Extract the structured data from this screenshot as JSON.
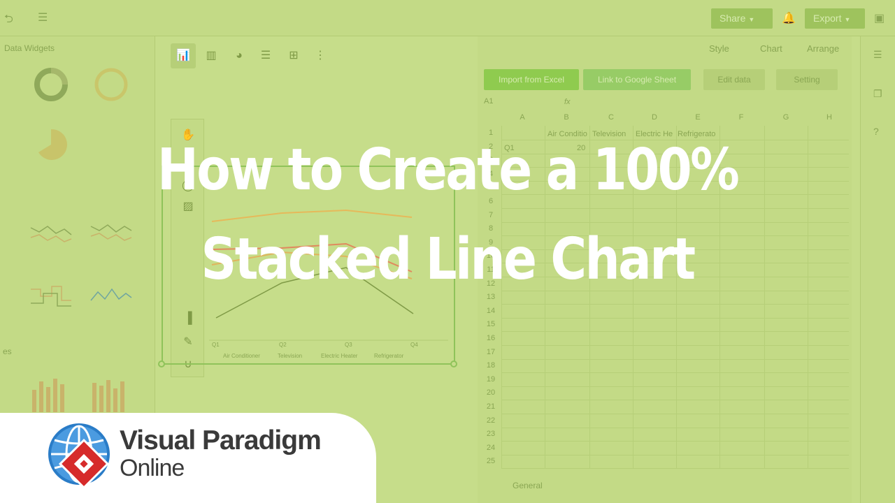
{
  "title": {
    "line1": "How to Create a 100%",
    "line2": "Stacked Line Chart"
  },
  "brand": {
    "name": "Visual Paradigm",
    "sub": "Online"
  },
  "topbar": {
    "share_label": "Share",
    "export_label": "Export"
  },
  "left_panel": {
    "title": "Data Widgets",
    "section2": "es"
  },
  "right_panel": {
    "tabs": [
      "Style",
      "Chart",
      "Arrange"
    ],
    "import_label": "Import from Excel",
    "google_label": "Link to Google Sheet",
    "edit_label": "Edit data",
    "setting_label": "Setting",
    "cell_ref": "A1",
    "fx": "fx",
    "sheet_tab": "General"
  },
  "sheet": {
    "columns": [
      "A",
      "B",
      "C",
      "D",
      "E",
      "F",
      "G",
      "H"
    ],
    "rows": [
      "1",
      "2",
      "3",
      "4",
      "5",
      "6",
      "7",
      "8",
      "9",
      "10",
      "11",
      "12",
      "13",
      "14",
      "15",
      "16",
      "17",
      "18",
      "19",
      "20",
      "21",
      "22",
      "23",
      "24",
      "25"
    ],
    "header_cells": [
      "Air Conditio",
      "Television",
      "Electric He",
      "Refrigerato"
    ],
    "row2": [
      "Q1",
      "20"
    ]
  },
  "chart_preview": {
    "legend": [
      "Air Conditioner",
      "Television",
      "Electric Heater",
      "Refrigerator"
    ],
    "xticks": [
      "Q1",
      "Q2",
      "Q3",
      "Q4"
    ]
  },
  "colors": {
    "overlay": "#b9d47a",
    "title": "#ffffff",
    "brand_text": "#3a3a3a",
    "logo_red": "#d62b2b",
    "logo_blue": "#2a7cc7"
  }
}
